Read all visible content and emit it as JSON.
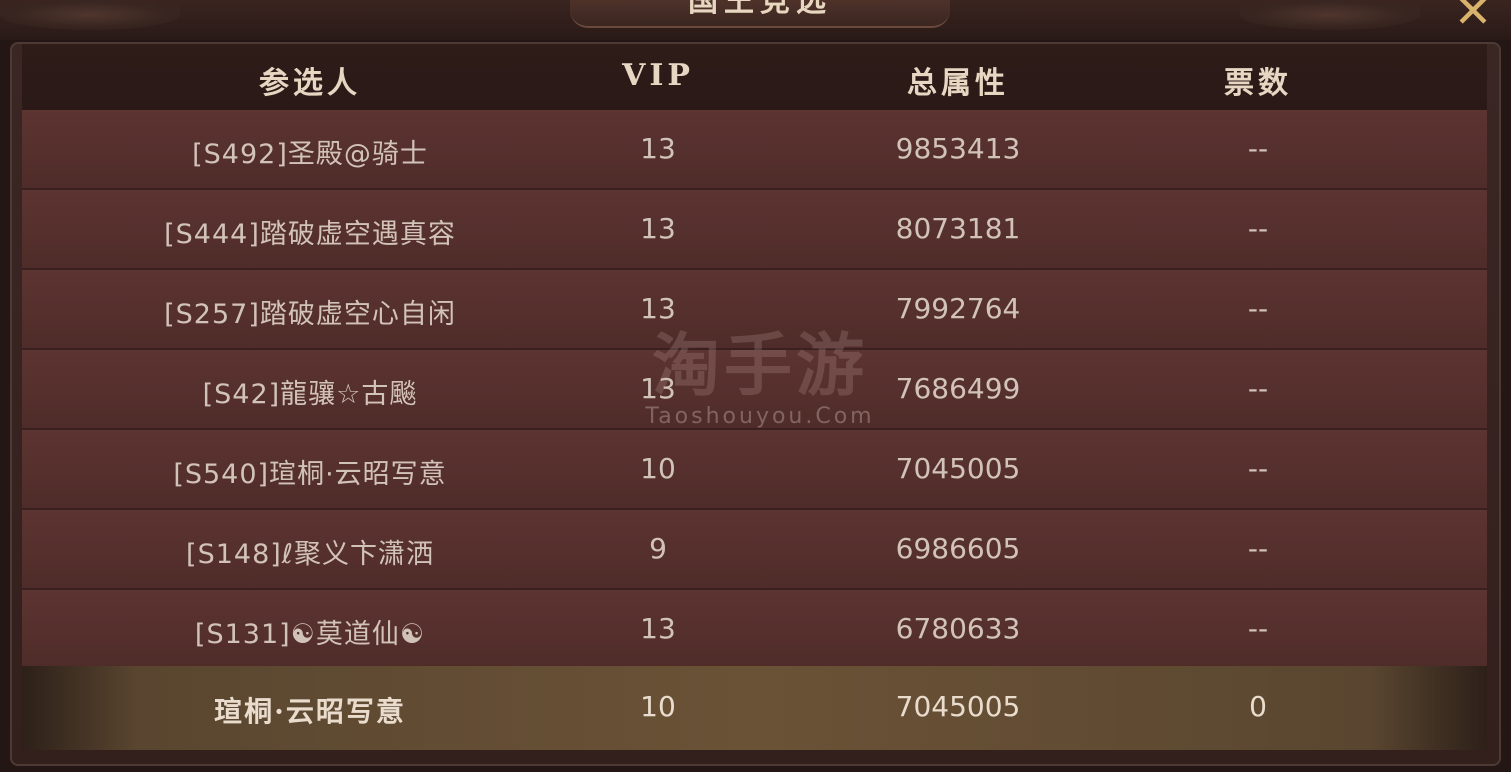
{
  "window": {
    "title": "国王竞选",
    "close_icon": "close-x-icon"
  },
  "table": {
    "headers": [
      "参选人",
      "VIP",
      "总属性",
      "票数"
    ],
    "rows": [
      {
        "name": "[S492]圣殿@骑士",
        "vip": "13",
        "power": "9853413",
        "votes": "--"
      },
      {
        "name": "[S444]踏破虚空遇真容",
        "vip": "13",
        "power": "8073181",
        "votes": "--"
      },
      {
        "name": "[S257]踏破虚空心自闲",
        "vip": "13",
        "power": "7992764",
        "votes": "--"
      },
      {
        "name": "[S42]龍骧☆古飈",
        "vip": "13",
        "power": "7686499",
        "votes": "--"
      },
      {
        "name": "[S540]瑄桐·云昭写意",
        "vip": "10",
        "power": "7045005",
        "votes": "--"
      },
      {
        "name": "[S148]ℓ聚义卞潇洒",
        "vip": "9",
        "power": "6986605",
        "votes": "--"
      },
      {
        "name": "[S131]☯莫道仙☯",
        "vip": "13",
        "power": "6780633",
        "votes": "--"
      }
    ],
    "self_row": {
      "name": "瑄桐·云昭写意",
      "vip": "10",
      "power": "7045005",
      "votes": "0"
    }
  },
  "watermark": {
    "main": "淘手游",
    "sub": "Taoshouyou.Com"
  },
  "colors": {
    "row_bg": "#5c3431",
    "header_bg": "#2e1c19",
    "self_row_bg": "#6a5236",
    "text": "#d2c3b8",
    "close_accent": "#d9b36c"
  }
}
